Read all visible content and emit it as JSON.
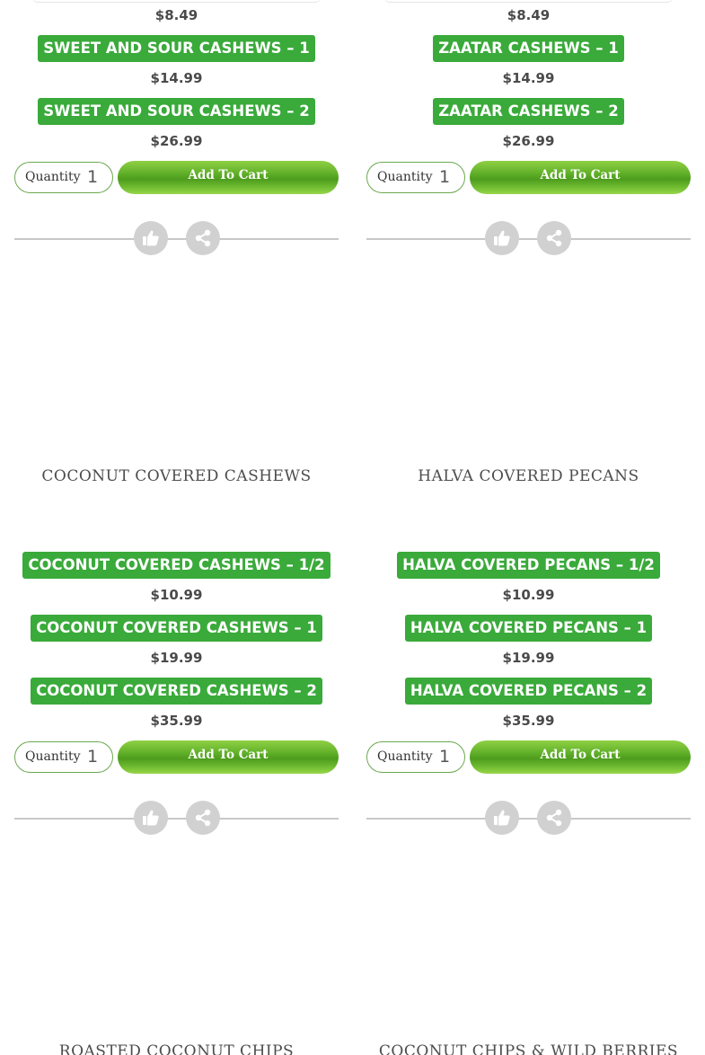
{
  "labels": {
    "quantity": "Quantity",
    "add_to_cart": "Add To Cart"
  },
  "products": [
    {
      "title": "",
      "top_price": "$8.49",
      "variants": [
        {
          "name": "SWEET AND SOUR CASHEWS – 1",
          "price": "$14.99"
        },
        {
          "name": "SWEET AND SOUR CASHEWS – 2",
          "price": "$26.99"
        }
      ],
      "quantity": "1"
    },
    {
      "title": "",
      "top_price": "$8.49",
      "variants": [
        {
          "name": "ZAATAR CASHEWS – 1",
          "price": "$14.99"
        },
        {
          "name": "ZAATAR CASHEWS – 2",
          "price": "$26.99"
        }
      ],
      "quantity": "1"
    },
    {
      "title": "COCONUT COVERED CASHEWS",
      "variants": [
        {
          "name": "COCONUT COVERED CASHEWS – 1/2",
          "price": "$10.99"
        },
        {
          "name": "COCONUT COVERED CASHEWS – 1",
          "price": "$19.99"
        },
        {
          "name": "COCONUT COVERED CASHEWS – 2",
          "price": "$35.99"
        }
      ],
      "quantity": "1"
    },
    {
      "title": "HALVA COVERED PECANS",
      "variants": [
        {
          "name": "HALVA COVERED PECANS – 1/2",
          "price": "$10.99"
        },
        {
          "name": "HALVA COVERED PECANS – 1",
          "price": "$19.99"
        },
        {
          "name": "HALVA COVERED PECANS – 2",
          "price": "$35.99"
        }
      ],
      "quantity": "1"
    },
    {
      "title": "ROASTED COCONUT CHIPS"
    },
    {
      "title": "COCONUT CHIPS & WILD BERRIES"
    }
  ],
  "icons": {
    "like": "thumbs-up-icon",
    "share": "share-icon"
  },
  "colors": {
    "variant_bg": "#3aaa3a",
    "cart_green": "#64b32b",
    "icon_circle": "#d1d1d1"
  }
}
